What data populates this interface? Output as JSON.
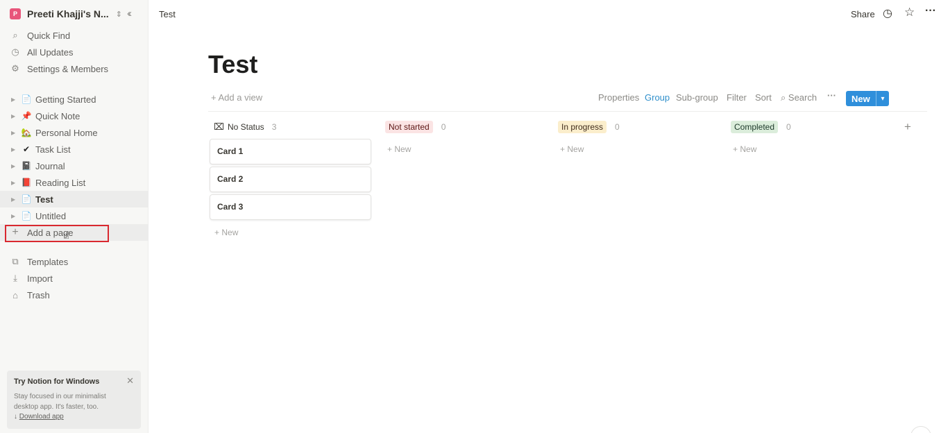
{
  "sidebar": {
    "workspace": {
      "logo": "P",
      "name": "Preeti Khajji's N..."
    },
    "nav": [
      {
        "icon": "search-icon",
        "glyph": "🔍",
        "label": "Quick Find"
      },
      {
        "icon": "clock-icon",
        "glyph": "◷",
        "label": "All Updates"
      },
      {
        "icon": "gear-icon",
        "glyph": "⚙",
        "label": "Settings & Members"
      }
    ],
    "pages": [
      {
        "emoji": "📄",
        "label": "Getting Started"
      },
      {
        "emoji": "📌",
        "label": "Quick Note"
      },
      {
        "emoji": "🏡",
        "label": "Personal Home"
      },
      {
        "emoji": "✔",
        "label": "Task List"
      },
      {
        "emoji": "📓",
        "label": "Journal"
      },
      {
        "emoji": "📕",
        "label": "Reading List"
      },
      {
        "emoji": "📄",
        "label": "Test"
      },
      {
        "emoji": "📄",
        "label": "Untitled"
      }
    ],
    "add_page": "Add a page",
    "bottom": [
      {
        "glyph": "⧉",
        "label": "Templates"
      },
      {
        "glyph": "⤓",
        "label": "Import"
      },
      {
        "glyph": "🗑",
        "label": "Trash"
      }
    ],
    "promo": {
      "title": "Try Notion for Windows",
      "text": "Stay focused in our minimalist desktop app. It's faster, too.",
      "arrow": "↓",
      "link": "Download app"
    }
  },
  "topbar": {
    "breadcrumb": "Test",
    "share": "Share"
  },
  "page": {
    "title": "Test",
    "add_view": "Add a view",
    "toolbar": {
      "properties": "Properties",
      "group": "Group",
      "subgroup": "Sub-group",
      "filter": "Filter",
      "sort": "Sort",
      "search": "Search",
      "new": "New"
    }
  },
  "board": {
    "columns": [
      {
        "label": "No Status",
        "count": "3",
        "color": "",
        "text_color": "#37352f"
      },
      {
        "label": "Not started",
        "count": "0",
        "color": "#fbe4e4",
        "text_color": "#5d1715"
      },
      {
        "label": "In progress",
        "count": "0",
        "color": "#fbeecc",
        "text_color": "#402c1b"
      },
      {
        "label": "Completed",
        "count": "0",
        "color": "#dbeddb",
        "text_color": "#1c3829"
      }
    ],
    "cards": [
      "Card 1",
      "Card 2",
      "Card 3"
    ],
    "new_label": "New"
  }
}
